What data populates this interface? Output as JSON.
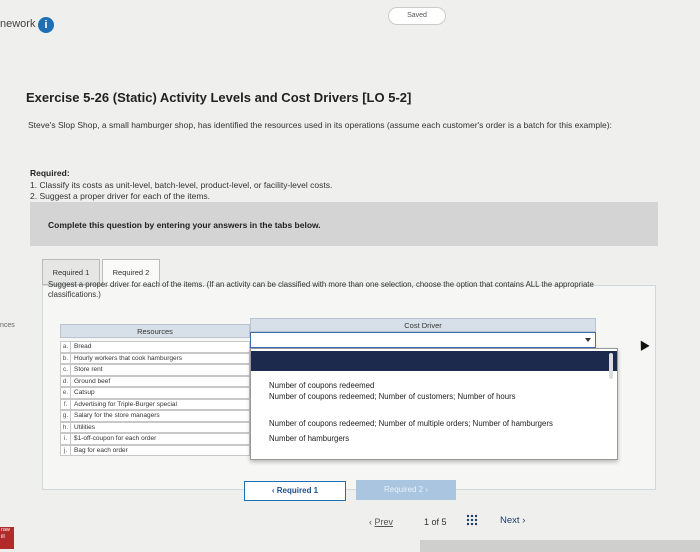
{
  "header": {
    "brand_fragment": "nework",
    "saved_label": "Saved"
  },
  "exercise": {
    "title": "Exercise 5-26 (Static) Activity Levels and Cost Drivers [LO 5-2]",
    "intro": "Steve's Slop Shop, a small hamburger shop, has identified the resources used in its operations (assume each customer's order is a batch for this example):",
    "required_heading": "Required:",
    "required_items": [
      "1. Classify its costs as unit-level, batch-level, product-level, or facility-level costs.",
      "2. Suggest a proper driver for each of the items."
    ]
  },
  "instruction": "Complete this question by entering your answers in the tabs below.",
  "tabs": [
    {
      "label": "Required 1"
    },
    {
      "label": "Required 2"
    }
  ],
  "panel_prompt": "Suggest a proper driver for each of the items. (If an activity can be classified with more than one selection, choose the option that contains ALL the appropriate classifications.)",
  "table": {
    "resources_header": "Resources",
    "cost_driver_header": "Cost Driver",
    "rows": [
      {
        "letter": "a.",
        "name": "Bread"
      },
      {
        "letter": "b.",
        "name": "Hourly workers that cook hamburgers"
      },
      {
        "letter": "c.",
        "name": "Store rent"
      },
      {
        "letter": "d.",
        "name": "Ground beef"
      },
      {
        "letter": "e.",
        "name": "Catsup"
      },
      {
        "letter": "f.",
        "name": "Advertising for Triple-Burger special"
      },
      {
        "letter": "g.",
        "name": "Salary for the store managers"
      },
      {
        "letter": "h.",
        "name": "Utilities"
      },
      {
        "letter": "i.",
        "name": "$1-off-coupon for each order"
      },
      {
        "letter": "j.",
        "name": "Bag for each order"
      }
    ]
  },
  "dropdown": {
    "options": [
      "Number of coupons redeemed",
      "Number of coupons redeemed; Number of customers; Number of hours",
      "Number of coupons redeemed; Number of multiple orders; Number of hamburgers",
      "Number of hamburgers"
    ]
  },
  "nav": {
    "prev_button": "Required 1",
    "next_button": "Required 2",
    "pager_prev": "Prev",
    "pager_count": "1 of 5",
    "pager_next": "Next"
  },
  "edge": {
    "left_fragment": "nces",
    "badge_text": "raw ill"
  },
  "colors": {
    "accent": "#1f6fb5",
    "dropdown_highlight": "#1c2a4e",
    "next_disabled": "#a9c5e0"
  }
}
